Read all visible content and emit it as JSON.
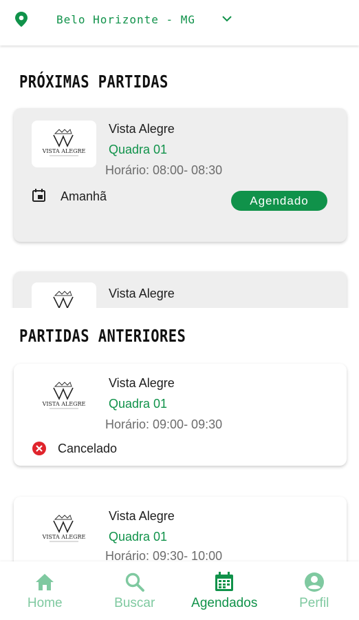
{
  "colors": {
    "brand_green": "#10924a",
    "inactive_green": "#7fc9a0",
    "cancel_red": "#e0242c"
  },
  "header": {
    "city": "Belo Horizonte - MG"
  },
  "upcoming": {
    "title": "PRÓXIMAS PARTIDAS",
    "cards": [
      {
        "venue": "Vista Alegre",
        "court": "Quadra 01",
        "time": "Horário: 08:00- 08:30",
        "day": "Amanhã",
        "badge": "Agendado"
      },
      {
        "venue": "Vista Alegre"
      }
    ]
  },
  "past": {
    "title": "PARTIDAS ANTERIORES",
    "cards": [
      {
        "venue": "Vista Alegre",
        "court": "Quadra 01",
        "time": "Horário: 09:00- 09:30",
        "status": "Cancelado"
      },
      {
        "venue": "Vista Alegre",
        "court": "Quadra 01",
        "time": "Horário: 09:30- 10:00"
      }
    ]
  },
  "nav": {
    "items": [
      {
        "label": "Home",
        "icon": "home-icon"
      },
      {
        "label": "Buscar",
        "icon": "search-icon"
      },
      {
        "label": "Agendados",
        "icon": "calendar-icon"
      },
      {
        "label": "Perfil",
        "icon": "profile-icon"
      }
    ],
    "active": "Agendados"
  },
  "logo_text": "VISTA ALEGRE"
}
